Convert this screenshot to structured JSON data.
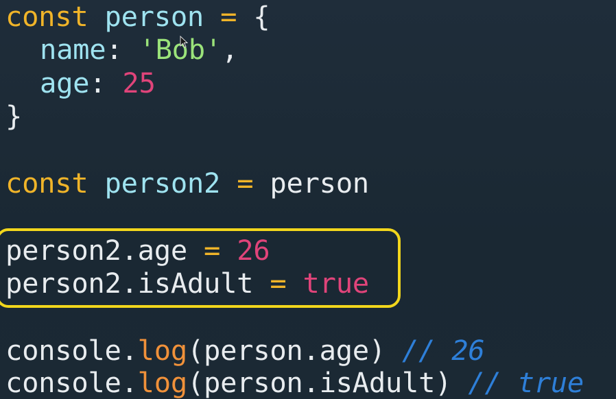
{
  "code": {
    "lines": [
      {
        "tokens": [
          {
            "text": "const",
            "type": "kw"
          },
          {
            "text": " ",
            "type": "plain"
          },
          {
            "text": "person",
            "type": "var"
          },
          {
            "text": " ",
            "type": "plain"
          },
          {
            "text": "=",
            "type": "op"
          },
          {
            "text": " {",
            "type": "plain"
          }
        ]
      },
      {
        "tokens": [
          {
            "text": "name",
            "type": "var"
          },
          {
            "text": ": ",
            "type": "plain"
          },
          {
            "text": "'Bob'",
            "type": "str"
          },
          {
            "text": ",",
            "type": "plain"
          }
        ]
      },
      {
        "tokens": [
          {
            "text": "age",
            "type": "var"
          },
          {
            "text": ": ",
            "type": "plain"
          },
          {
            "text": "25",
            "type": "num"
          }
        ]
      },
      {
        "tokens": [
          {
            "text": "}",
            "type": "plain"
          }
        ]
      },
      {
        "tokens": [
          {
            "text": "const",
            "type": "kw"
          },
          {
            "text": " ",
            "type": "plain"
          },
          {
            "text": "person2",
            "type": "var"
          },
          {
            "text": " ",
            "type": "plain"
          },
          {
            "text": "=",
            "type": "op"
          },
          {
            "text": " person",
            "type": "plain"
          }
        ]
      },
      {
        "tokens": [
          {
            "text": "person2.age",
            "type": "plain"
          },
          {
            "text": " ",
            "type": "plain"
          },
          {
            "text": "=",
            "type": "op"
          },
          {
            "text": " ",
            "type": "plain"
          },
          {
            "text": "26",
            "type": "num"
          }
        ]
      },
      {
        "tokens": [
          {
            "text": "person2.isAdult",
            "type": "plain"
          },
          {
            "text": " ",
            "type": "plain"
          },
          {
            "text": "=",
            "type": "op"
          },
          {
            "text": " ",
            "type": "plain"
          },
          {
            "text": "true",
            "type": "num"
          }
        ]
      },
      {
        "tokens": [
          {
            "text": "console.",
            "type": "plain"
          },
          {
            "text": "log",
            "type": "fn"
          },
          {
            "text": "(person.age)",
            "type": "plain"
          },
          {
            "text": " ",
            "type": "plain"
          },
          {
            "text": "// 26",
            "type": "cmt"
          }
        ]
      },
      {
        "tokens": [
          {
            "text": "console.",
            "type": "plain"
          },
          {
            "text": "log",
            "type": "fn"
          },
          {
            "text": "(person.isAdult)",
            "type": "plain"
          },
          {
            "text": " ",
            "type": "plain"
          },
          {
            "text": "// true",
            "type": "cmt"
          }
        ]
      }
    ]
  },
  "colors": {
    "background": "#1c2a36",
    "keyword": "#f0b429",
    "identifier": "#9fe3f0",
    "string": "#9be37a",
    "number": "#e0447a",
    "function": "#f0913a",
    "comment": "#2e7fd8",
    "highlight_border": "#f2d61c"
  },
  "icons": {
    "mouse_cursor": "mouse-pointer-icon"
  }
}
